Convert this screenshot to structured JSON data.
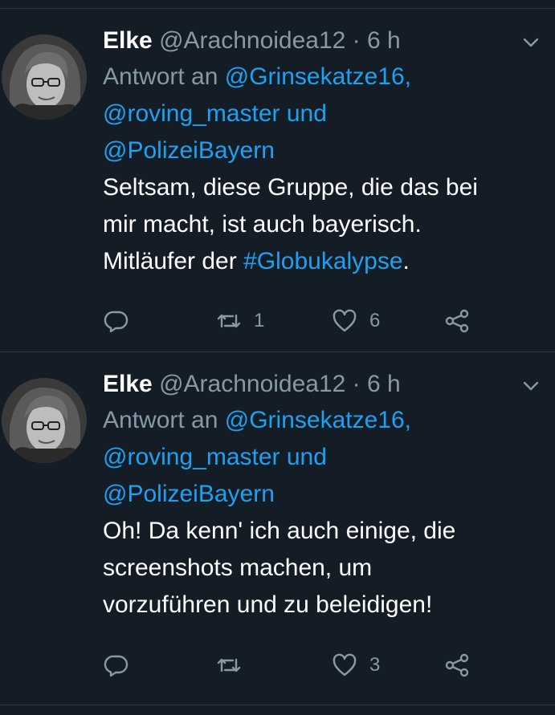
{
  "tweets": [
    {
      "name": "Elke",
      "handle": "@Arachnoidea12",
      "sep": " · ",
      "time": "6 h",
      "reply_prefix": "Antwort an ",
      "reply_user1": "@Grinsekatze16,",
      "reply_user2": "@roving_master und",
      "reply_user3": "@PolizeiBayern",
      "text_line1": "Seltsam, diese Gruppe, die das bei",
      "text_line2": "mir macht, ist auch bayerisch.",
      "text_line3_prefix": "Mitläufer der ",
      "hashtag": "#Globukalypse",
      "text_line3_suffix": ".",
      "retweet_count": "1",
      "like_count": "6"
    },
    {
      "name": "Elke",
      "handle": "@Arachnoidea12",
      "sep": " · ",
      "time": "6 h",
      "reply_prefix": "Antwort an ",
      "reply_user1": "@Grinsekatze16,",
      "reply_user2": "@roving_master und",
      "reply_user3": "@PolizeiBayern",
      "text_line1": "Oh! Da kenn' ich auch einige, die",
      "text_line2": "screenshots machen, um",
      "text_line3": "vorzuführen und zu beleidigen!",
      "retweet_count": "",
      "like_count": "3"
    }
  ],
  "colors": {
    "background": "#141d26",
    "link": "#1da1f2",
    "muted": "#8899a6",
    "divider": "#2a3744"
  },
  "icons": [
    "reply-icon",
    "retweet-icon",
    "like-icon",
    "share-icon",
    "chevron-down-icon"
  ]
}
